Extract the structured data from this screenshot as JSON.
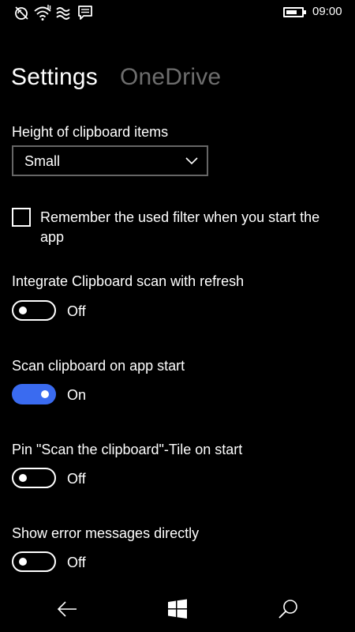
{
  "status_bar": {
    "time": "09:00",
    "icons": [
      "do-not-disturb-icon",
      "wifi-icon",
      "hotspot-icon",
      "message-icon",
      "battery-icon"
    ],
    "battery_level": 0.7
  },
  "pivot": {
    "tabs": [
      {
        "label": "Settings",
        "active": true
      },
      {
        "label": "OneDrive",
        "active": false
      }
    ]
  },
  "settings": {
    "clipboard_height": {
      "label": "Height of clipboard items",
      "selected": "Small"
    },
    "remember_filter": {
      "label": "Remember the used filter when you start the app",
      "checked": false
    },
    "integrate_scan": {
      "label": "Integrate Clipboard scan with refresh",
      "state": "Off"
    },
    "scan_on_start": {
      "label": "Scan clipboard on app start",
      "state": "On"
    },
    "pin_tile": {
      "label": "Pin \"Scan the clipboard\"-Tile on start",
      "state": "Off"
    },
    "show_errors": {
      "label": "Show error messages directly",
      "state": "Off"
    }
  },
  "colors": {
    "accent": "#3a6bf0",
    "background": "#000000",
    "inactive_text": "#6d6d6d"
  },
  "nav_bar": {
    "icons": [
      "back-arrow-icon",
      "windows-logo-icon",
      "search-icon"
    ]
  }
}
